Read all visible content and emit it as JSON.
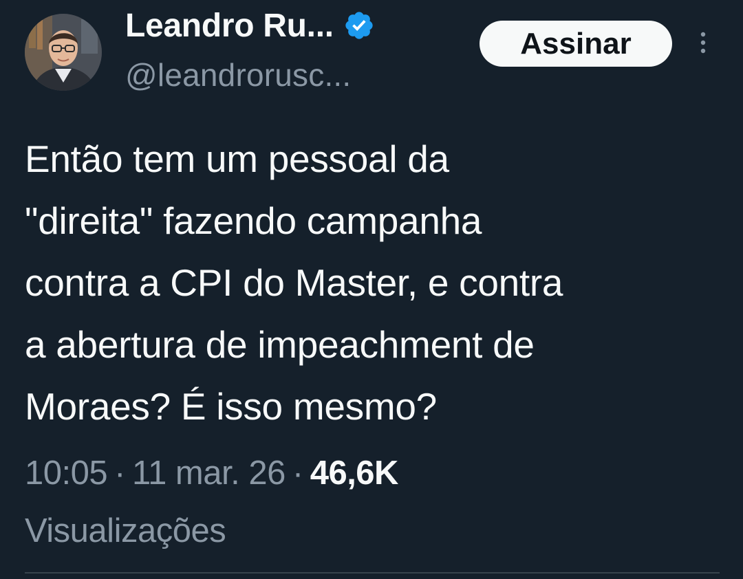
{
  "author": {
    "display_name": "Leandro Ru...",
    "handle": "@leandrorusc...",
    "verified": true,
    "avatar_icon": "profile-photo"
  },
  "header": {
    "subscribe_label": "Assinar",
    "more_icon": "vertical-ellipsis-icon"
  },
  "tweet": {
    "lines": [
      "Então tem um pessoal da",
      "\"direita\" fazendo campanha",
      "contra a CPI do Master, e contra",
      "a abertura de impeachment de",
      "Moraes? É isso mesmo?"
    ]
  },
  "meta": {
    "time": "10:05",
    "separator": "·",
    "date": "11 mar. 26",
    "views_count": "46,6K",
    "views_label": "Visualizações"
  },
  "colors": {
    "background": "#15202b",
    "text_primary": "#f7f9f9",
    "text_secondary": "#8b98a5",
    "verified_blue": "#1d9bf0",
    "divider": "#38444d"
  }
}
